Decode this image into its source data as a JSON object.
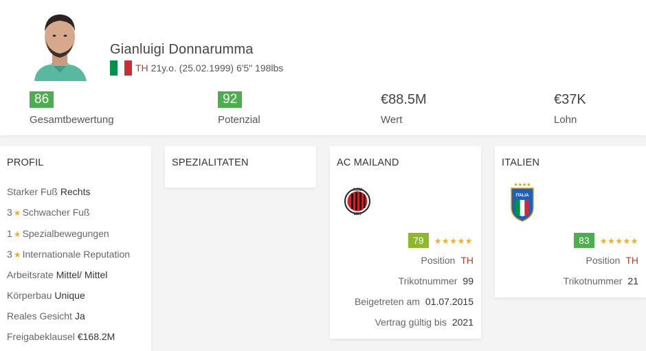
{
  "player": {
    "name": "Gianluigi Donnarumma",
    "position": "TH",
    "details": "21y.o. (25.02.1999) 6'5\" 198lbs",
    "flag_colors": [
      "#009246",
      "#ffffff",
      "#ce2b37"
    ]
  },
  "stats": [
    {
      "value": "86",
      "label": "Gesamtbewertung",
      "color": "#4cae4c"
    },
    {
      "value": "92",
      "label": "Potenzial",
      "color": "#4cae4c"
    },
    {
      "value": "€88.5M",
      "label": "Wert"
    },
    {
      "value": "€37K",
      "label": "Lohn"
    }
  ],
  "profile": {
    "title": "PROFIL",
    "rows": [
      {
        "label": "Starker Fuß",
        "value": "Rechts"
      },
      {
        "prefix": "3",
        "label": "Schwacher Fuß"
      },
      {
        "prefix": "1",
        "label": "Spezialbewegungen"
      },
      {
        "prefix": "3",
        "label": "Internationale Reputation"
      },
      {
        "label": "Arbeitsrate",
        "value": "Mittel/ Mittel"
      },
      {
        "label": "Körperbau",
        "value": "Unique"
      },
      {
        "label": "Reales Gesicht",
        "value": "Ja"
      },
      {
        "label": "Freigabeklausel",
        "value": "€168.2M"
      }
    ]
  },
  "specialities": {
    "title": "SPEZIALITATEN"
  },
  "club": {
    "title": "AC MAILAND",
    "rating": "79",
    "rating_color": "#8cb82a",
    "stars": "★★★★★",
    "logo_text": "ACM",
    "logo_year": "1899",
    "position_label": "Position",
    "position_value": "TH",
    "jersey_label": "Trikotnummer",
    "jersey_value": "99",
    "joined_label": "Beigetreten am",
    "joined_value": "01.07.2015",
    "contract_label": "Vertrag gültig bis",
    "contract_value": "2021"
  },
  "nation": {
    "title": "ITALIEN",
    "rating": "83",
    "rating_color": "#4cae4c",
    "stars": "★★★★★",
    "logo_text": "ITALIA",
    "position_label": "Position",
    "position_value": "TH",
    "jersey_label": "Trikotnummer",
    "jersey_value": "21"
  },
  "icons": {
    "star": "★"
  }
}
